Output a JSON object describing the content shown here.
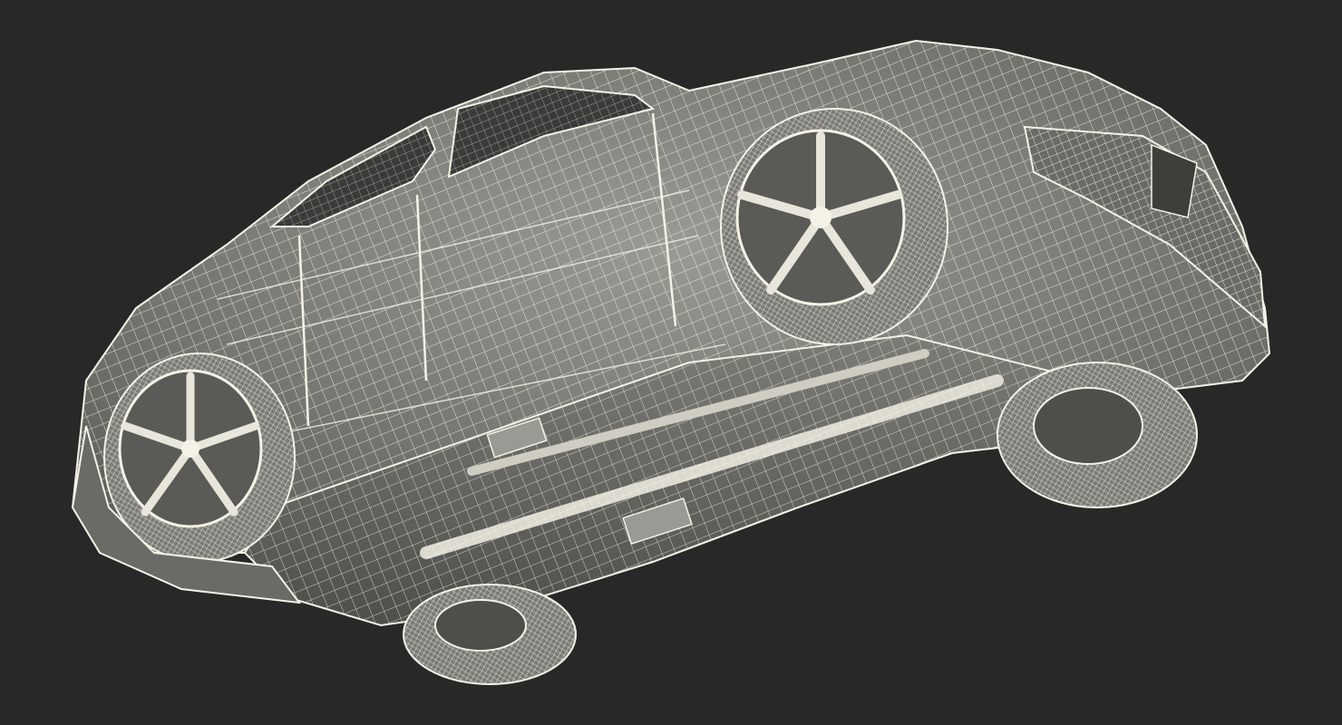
{
  "scene": {
    "subject": "wireframe-car-underside",
    "background_color": "#282828",
    "shell_color": "#8a8a86",
    "shell_dark_color": "#5c5c59",
    "wire_color": "#f4f2e6",
    "underbody_color": "#6e6e6a"
  }
}
